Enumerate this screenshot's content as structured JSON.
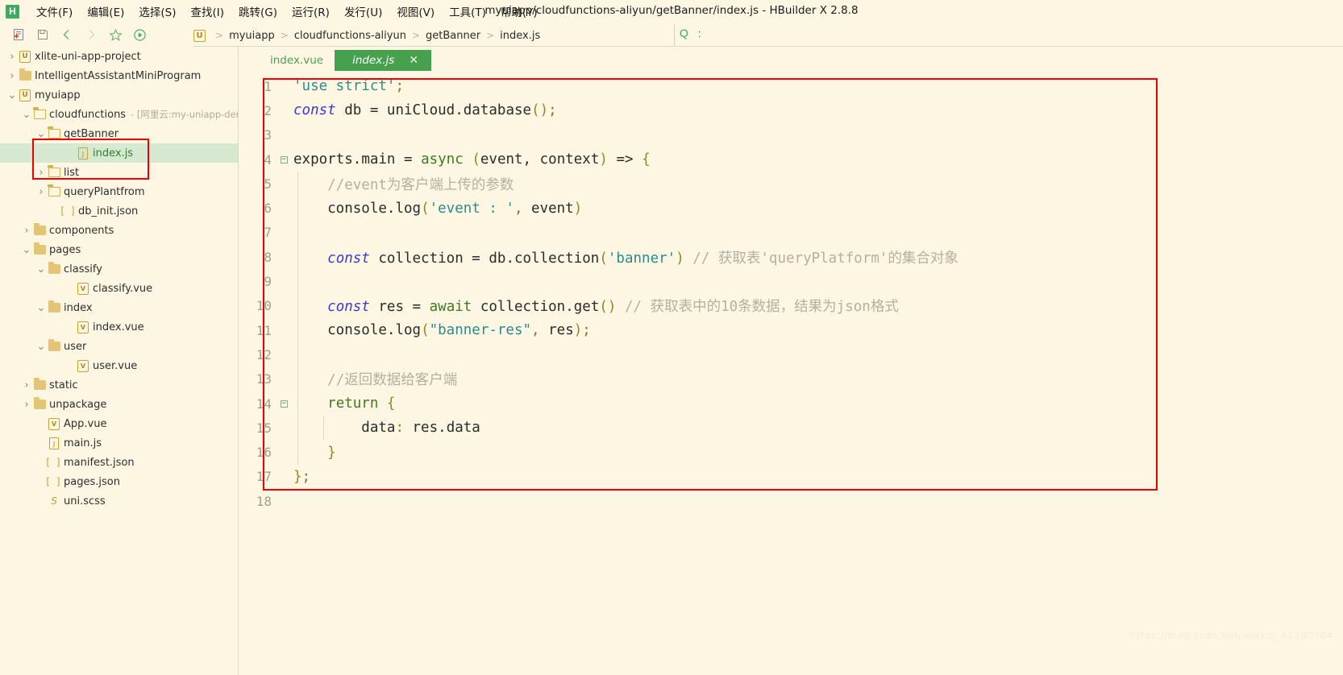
{
  "window": {
    "title": "myuiapp/cloudfunctions-aliyun/getBanner/index.js - HBuilder X 2.8.8",
    "logo_letter": "H"
  },
  "menubar": {
    "items": [
      {
        "label": "文件(F)"
      },
      {
        "label": "编辑(E)"
      },
      {
        "label": "选择(S)"
      },
      {
        "label": "查找(I)"
      },
      {
        "label": "跳转(G)"
      },
      {
        "label": "运行(R)"
      },
      {
        "label": "发行(U)"
      },
      {
        "label": "视图(V)"
      },
      {
        "label": "工具(T)"
      },
      {
        "label": "帮助(Y)"
      }
    ]
  },
  "toolbar": {
    "buttons": [
      {
        "name": "new-file-icon"
      },
      {
        "name": "save-icon"
      },
      {
        "name": "back-icon"
      },
      {
        "name": "forward-icon"
      },
      {
        "name": "favorite-star-icon"
      },
      {
        "name": "run-icon"
      }
    ],
    "search_icon": "Q",
    "more_icon": ":"
  },
  "breadcrumb": {
    "project_badge": "U",
    "segments": [
      "myuiapp",
      "cloudfunctions-aliyun",
      "getBanner",
      "index.js"
    ],
    "separator": ">"
  },
  "sidebar": {
    "rows": [
      {
        "indent": 0,
        "twisty": "collapsed",
        "icon": "uniapp-project-icon",
        "icon_letter": "U",
        "label": "xlite-uni-app-project",
        "suffix": "",
        "selected": false
      },
      {
        "indent": 0,
        "twisty": "collapsed",
        "icon": "folder-closed-icon",
        "icon_letter": "",
        "label": "IntelligentAssistantMiniProgram",
        "suffix": "",
        "selected": false
      },
      {
        "indent": 0,
        "twisty": "expanded",
        "icon": "uniapp-project-icon",
        "icon_letter": "U",
        "label": "myuiapp",
        "suffix": "",
        "selected": false
      },
      {
        "indent": 1,
        "twisty": "expanded",
        "icon": "folder-open-icon",
        "icon_letter": "",
        "label": "cloudfunctions",
        "suffix": " - [阿里云:my-uniapp-demo]",
        "selected": false
      },
      {
        "indent": 2,
        "twisty": "expanded",
        "icon": "folder-open-icon",
        "icon_letter": "",
        "label": "getBanner",
        "suffix": "",
        "selected": false
      },
      {
        "indent": 4,
        "twisty": "none",
        "icon": "js-file-icon",
        "icon_letter": "J",
        "label": "index.js",
        "suffix": "",
        "selected": true
      },
      {
        "indent": 2,
        "twisty": "collapsed",
        "icon": "folder-open-icon",
        "icon_letter": "",
        "label": "list",
        "suffix": "",
        "selected": false
      },
      {
        "indent": 2,
        "twisty": "collapsed",
        "icon": "folder-open-icon",
        "icon_letter": "",
        "label": "queryPlantfrom",
        "suffix": "",
        "selected": false
      },
      {
        "indent": 3,
        "twisty": "none",
        "icon": "json-file-icon",
        "icon_letter": "",
        "label": "db_init.json",
        "suffix": "",
        "selected": false
      },
      {
        "indent": 1,
        "twisty": "collapsed",
        "icon": "folder-closed-icon",
        "icon_letter": "",
        "label": "components",
        "suffix": "",
        "selected": false
      },
      {
        "indent": 1,
        "twisty": "expanded",
        "icon": "folder-closed-icon",
        "icon_letter": "",
        "label": "pages",
        "suffix": "",
        "selected": false
      },
      {
        "indent": 2,
        "twisty": "expanded",
        "icon": "folder-closed-icon",
        "icon_letter": "",
        "label": "classify",
        "suffix": "",
        "selected": false
      },
      {
        "indent": 4,
        "twisty": "none",
        "icon": "vue-file-icon",
        "icon_letter": "V",
        "label": "classify.vue",
        "suffix": "",
        "selected": false
      },
      {
        "indent": 2,
        "twisty": "expanded",
        "icon": "folder-closed-icon",
        "icon_letter": "",
        "label": "index",
        "suffix": "",
        "selected": false
      },
      {
        "indent": 4,
        "twisty": "none",
        "icon": "vue-file-icon",
        "icon_letter": "V",
        "label": "index.vue",
        "suffix": "",
        "selected": false
      },
      {
        "indent": 2,
        "twisty": "expanded",
        "icon": "folder-closed-icon",
        "icon_letter": "",
        "label": "user",
        "suffix": "",
        "selected": false
      },
      {
        "indent": 4,
        "twisty": "none",
        "icon": "vue-file-icon",
        "icon_letter": "V",
        "label": "user.vue",
        "suffix": "",
        "selected": false
      },
      {
        "indent": 1,
        "twisty": "collapsed",
        "icon": "folder-closed-icon",
        "icon_letter": "",
        "label": "static",
        "suffix": "",
        "selected": false
      },
      {
        "indent": 1,
        "twisty": "collapsed",
        "icon": "folder-closed-icon",
        "icon_letter": "",
        "label": "unpackage",
        "suffix": "",
        "selected": false
      },
      {
        "indent": 2,
        "twisty": "none",
        "icon": "vue-file-icon",
        "icon_letter": "V",
        "label": "App.vue",
        "suffix": "",
        "selected": false
      },
      {
        "indent": 2,
        "twisty": "none",
        "icon": "js-file-icon",
        "icon_letter": "J",
        "label": "main.js",
        "suffix": "",
        "selected": false
      },
      {
        "indent": 2,
        "twisty": "none",
        "icon": "json-file-icon",
        "icon_letter": "",
        "label": "manifest.json",
        "suffix": "",
        "selected": false
      },
      {
        "indent": 2,
        "twisty": "none",
        "icon": "json-file-icon",
        "icon_letter": "",
        "label": "pages.json",
        "suffix": "",
        "selected": false
      },
      {
        "indent": 2,
        "twisty": "none",
        "icon": "scss-file-icon",
        "icon_letter": "",
        "label": "uni.scss",
        "suffix": "",
        "selected": false
      }
    ]
  },
  "editor": {
    "tabs": [
      {
        "label": "index.vue",
        "active": false,
        "closable": false
      },
      {
        "label": "index.js",
        "active": true,
        "closable": true,
        "close_glyph": "✕"
      }
    ],
    "lines": [
      {
        "num": "1",
        "fold": "",
        "guides": 0,
        "tokens": [
          {
            "t": "'use strict'",
            "c": "str"
          },
          {
            "t": ";",
            "c": "punct"
          }
        ]
      },
      {
        "num": "2",
        "fold": "",
        "guides": 0,
        "tokens": [
          {
            "t": "const",
            "c": "kw"
          },
          {
            "t": " db ",
            "c": "plain"
          },
          {
            "t": "=",
            "c": "plain"
          },
          {
            "t": " uniCloud",
            "c": "plain"
          },
          {
            "t": ".",
            "c": "plain"
          },
          {
            "t": "database",
            "c": "plain"
          },
          {
            "t": "()",
            "c": "paren"
          },
          {
            "t": ";",
            "c": "punct"
          }
        ]
      },
      {
        "num": "3",
        "fold": "",
        "guides": 0,
        "tokens": []
      },
      {
        "num": "4",
        "fold": "minus",
        "guides": 0,
        "tokens": [
          {
            "t": "exports",
            "c": "plain"
          },
          {
            "t": ".",
            "c": "plain"
          },
          {
            "t": "main ",
            "c": "plain"
          },
          {
            "t": "=",
            "c": "plain"
          },
          {
            "t": " ",
            "c": "plain"
          },
          {
            "t": "async",
            "c": "green"
          },
          {
            "t": " ",
            "c": "plain"
          },
          {
            "t": "(",
            "c": "paren"
          },
          {
            "t": "event, context",
            "c": "plain"
          },
          {
            "t": ")",
            "c": "paren"
          },
          {
            "t": " ",
            "c": "plain"
          },
          {
            "t": "=>",
            "c": "plain"
          },
          {
            "t": " ",
            "c": "plain"
          },
          {
            "t": "{",
            "c": "paren"
          }
        ]
      },
      {
        "num": "5",
        "fold": "",
        "guides": 1,
        "tokens": [
          {
            "t": "    ",
            "c": "plain"
          },
          {
            "t": "//event为客户端上传的参数",
            "c": "com"
          }
        ]
      },
      {
        "num": "6",
        "fold": "",
        "guides": 1,
        "tokens": [
          {
            "t": "    console",
            "c": "plain"
          },
          {
            "t": ".",
            "c": "plain"
          },
          {
            "t": "log",
            "c": "plain"
          },
          {
            "t": "(",
            "c": "paren"
          },
          {
            "t": "'event : '",
            "c": "str"
          },
          {
            "t": ",",
            "c": "punct"
          },
          {
            "t": " event",
            "c": "plain"
          },
          {
            "t": ")",
            "c": "paren"
          }
        ]
      },
      {
        "num": "7",
        "fold": "",
        "guides": 1,
        "tokens": []
      },
      {
        "num": "8",
        "fold": "",
        "guides": 1,
        "tokens": [
          {
            "t": "    ",
            "c": "plain"
          },
          {
            "t": "const",
            "c": "kw"
          },
          {
            "t": " collection ",
            "c": "plain"
          },
          {
            "t": "=",
            "c": "plain"
          },
          {
            "t": " db",
            "c": "plain"
          },
          {
            "t": ".",
            "c": "plain"
          },
          {
            "t": "collection",
            "c": "plain"
          },
          {
            "t": "(",
            "c": "paren"
          },
          {
            "t": "'banner'",
            "c": "str"
          },
          {
            "t": ")",
            "c": "paren"
          },
          {
            "t": " ",
            "c": "plain"
          },
          {
            "t": "// 获取表'queryPlatform'的集合对象",
            "c": "com"
          }
        ]
      },
      {
        "num": "9",
        "fold": "",
        "guides": 1,
        "tokens": []
      },
      {
        "num": "10",
        "fold": "",
        "guides": 1,
        "tokens": [
          {
            "t": "    ",
            "c": "plain"
          },
          {
            "t": "const",
            "c": "kw"
          },
          {
            "t": " res ",
            "c": "plain"
          },
          {
            "t": "=",
            "c": "plain"
          },
          {
            "t": " ",
            "c": "plain"
          },
          {
            "t": "await",
            "c": "green"
          },
          {
            "t": " collection",
            "c": "plain"
          },
          {
            "t": ".",
            "c": "plain"
          },
          {
            "t": "get",
            "c": "plain"
          },
          {
            "t": "()",
            "c": "paren"
          },
          {
            "t": " ",
            "c": "plain"
          },
          {
            "t": "// 获取表中的10条数据，结果为json格式",
            "c": "com"
          }
        ]
      },
      {
        "num": "11",
        "fold": "",
        "guides": 1,
        "tokens": [
          {
            "t": "    console",
            "c": "plain"
          },
          {
            "t": ".",
            "c": "plain"
          },
          {
            "t": "log",
            "c": "plain"
          },
          {
            "t": "(",
            "c": "paren"
          },
          {
            "t": "\"banner-res\"",
            "c": "str"
          },
          {
            "t": ",",
            "c": "punct"
          },
          {
            "t": " res",
            "c": "plain"
          },
          {
            "t": ")",
            "c": "paren"
          },
          {
            "t": ";",
            "c": "punct"
          }
        ]
      },
      {
        "num": "12",
        "fold": "",
        "guides": 1,
        "tokens": []
      },
      {
        "num": "13",
        "fold": "",
        "guides": 1,
        "tokens": [
          {
            "t": "    ",
            "c": "plain"
          },
          {
            "t": "//返回数据给客户端",
            "c": "com"
          }
        ]
      },
      {
        "num": "14",
        "fold": "minus",
        "guides": 1,
        "tokens": [
          {
            "t": "    ",
            "c": "plain"
          },
          {
            "t": "return",
            "c": "green"
          },
          {
            "t": " ",
            "c": "plain"
          },
          {
            "t": "{",
            "c": "paren"
          }
        ]
      },
      {
        "num": "15",
        "fold": "",
        "guides": 2,
        "tokens": [
          {
            "t": "        data",
            "c": "plain"
          },
          {
            "t": ":",
            "c": "punct"
          },
          {
            "t": " res",
            "c": "plain"
          },
          {
            "t": ".",
            "c": "plain"
          },
          {
            "t": "data",
            "c": "plain"
          }
        ]
      },
      {
        "num": "16",
        "fold": "",
        "guides": 1,
        "tokens": [
          {
            "t": "    ",
            "c": "plain"
          },
          {
            "t": "}",
            "c": "paren"
          }
        ]
      },
      {
        "num": "17",
        "fold": "",
        "guides": 0,
        "tokens": [
          {
            "t": "}",
            "c": "paren"
          },
          {
            "t": ";",
            "c": "punct"
          }
        ]
      },
      {
        "num": "18",
        "fold": "",
        "guides": 0,
        "tokens": []
      }
    ]
  },
  "annotations": {
    "tree_highlight_color": "#ee0000",
    "code_highlight_color": "#ee0000"
  },
  "watermark": "https://blog.csdn.net/weixin_42580704"
}
